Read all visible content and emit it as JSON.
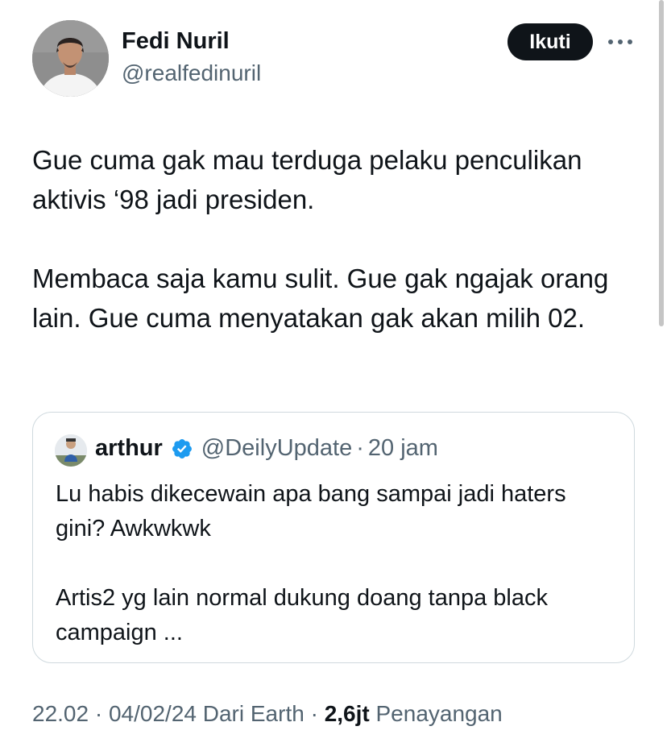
{
  "author": {
    "name": "Fedi Nuril",
    "handle": "@realfedinuril",
    "avatar_icon": "profile-photo"
  },
  "actions": {
    "follow_label": "Ikuti",
    "more_icon": "more-horizontal-icon"
  },
  "tweet": {
    "paragraphs": [
      "Gue cuma gak mau terduga pelaku penculikan aktivis ‘98 jadi presiden.",
      "Membaca saja kamu sulit. Gue gak ngajak orang lain. Gue cuma menyatakan gak akan milih 02."
    ]
  },
  "quote": {
    "name": "arthur",
    "verified_color": "#1d9bf0",
    "handle": "@DeilyUpdate",
    "separator": "·",
    "time": "20 jam",
    "paragraphs": [
      "Lu habis dikecewain apa bang sampai jadi haters gini? Awkwkwk",
      "Artis2 yg lain normal dukung doang tanpa black campaign ..."
    ]
  },
  "meta": {
    "time": "22.02",
    "sep1": "·",
    "date": "04/02/24",
    "source": "Dari Earth",
    "sep2": "·",
    "views_count": "2,6jt",
    "views_label": "Penayangan"
  },
  "colors": {
    "text_primary": "#0f1419",
    "text_secondary": "#536471",
    "border": "#cfd9de",
    "button_bg": "#0f1419"
  }
}
